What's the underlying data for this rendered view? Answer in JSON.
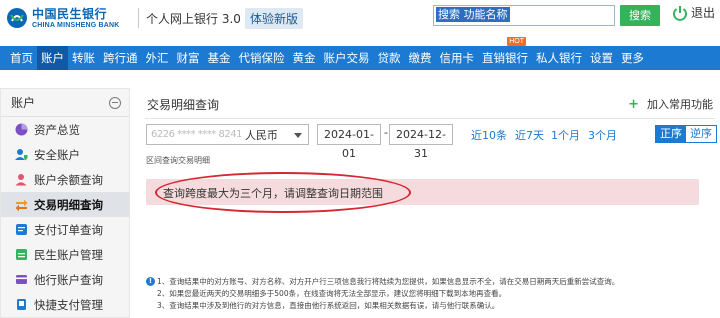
{
  "header": {
    "logo_cn": "中国民生银行",
    "logo_en": "CHINA MINSHENG BANK",
    "app_title": "个人网上银行 3.0",
    "badge": "体验新版",
    "search_value": "搜索 功能名称",
    "search_button": "搜索",
    "logout_label": "退出"
  },
  "nav": {
    "items": [
      "首页",
      "账户",
      "转账",
      "跨行通",
      "外汇",
      "财富",
      "基金",
      "代销保险",
      "黄金",
      "账户交易",
      "贷款",
      "缴费",
      "信用卡",
      "直销银行",
      "私人银行",
      "设置",
      "更多"
    ],
    "active_index": 1,
    "hot_label": "HOT",
    "hot_index": 13
  },
  "sidebar": {
    "title": "账户",
    "items": [
      {
        "label": "资产总览",
        "icon": "pie-chart-icon"
      },
      {
        "label": "安全账户",
        "icon": "user-shield-icon"
      },
      {
        "label": "账户余额查询",
        "icon": "user-icon"
      },
      {
        "label": "交易明细查询",
        "icon": "arrows-icon"
      },
      {
        "label": "支付订单查询",
        "icon": "order-icon"
      },
      {
        "label": "民生账户管理",
        "icon": "account-icon"
      },
      {
        "label": "他行账户查询",
        "icon": "other-bank-icon"
      },
      {
        "label": "快捷支付管理",
        "icon": "quick-pay-icon"
      }
    ],
    "active_index": 3
  },
  "main": {
    "title": "交易明细查询",
    "add_favorite": "加入常用功能",
    "account_masked": "6226 **** **** 8241",
    "currency": "人民币",
    "date_start": "2024-01-01",
    "date_sep": "-",
    "date_end": "2024-12-31",
    "quick_ranges": [
      "近10条",
      "近7天",
      "1个月",
      "3个月"
    ],
    "order_asc": "正序",
    "order_desc": "逆序",
    "range_label": "区间查询交易明细",
    "alert": "查询跨度最大为三个月，请调整查询日期范围",
    "notes": [
      "1、查询结果中的对方账号、对方名称、对方开户行三项信息我行将陆续为您提供，如果信息显示不全，请在交易日期两天后重新尝试查询。",
      "2、如果您最近两天的交易明细多于500条，在线查询将无法全部显示，建议您将明细下载到本地再查看。",
      "3、查询结果中涉及到他行的对方信息，直接由他行系统返回，如果相关数据有误，请与他行联系确认。"
    ]
  },
  "colors": {
    "brand_blue": "#1d7ad2",
    "nav_active": "#0e5aa8",
    "success_green": "#33b35a",
    "alert_bg": "#f5dbdd",
    "annotation_red": "#d52832"
  }
}
